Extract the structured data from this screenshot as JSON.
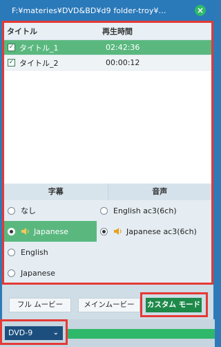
{
  "window": {
    "title": "F:¥materies¥DVD&BD¥d9 folder-troy¥…",
    "close_icon": "×"
  },
  "titles_table": {
    "headers": {
      "title": "タイトル",
      "duration": "再生時間"
    },
    "rows": [
      {
        "name": "タイトル_1",
        "duration": "02:42:36",
        "checked": true,
        "selected": true
      },
      {
        "name": "タイトル_2",
        "duration": "00:00:12",
        "checked": true,
        "selected": false
      }
    ]
  },
  "tracks": {
    "subtitle_header": "字幕",
    "audio_header": "音声",
    "subtitles": [
      {
        "label": "なし",
        "selected": false
      },
      {
        "label": "Japanese",
        "selected": true,
        "icon": "speaker-icon"
      },
      {
        "label": "English",
        "selected": false
      },
      {
        "label": "Japanese",
        "selected": false
      }
    ],
    "audio": [
      {
        "label": "English ac3(6ch)",
        "selected": false
      },
      {
        "label": "Japanese ac3(6ch)",
        "selected": true,
        "icon": "speaker-icon"
      }
    ]
  },
  "modes": {
    "full_movie": "フル ムービー",
    "main_movie": "メインムービー",
    "custom_mode": "カスタム モード"
  },
  "output": {
    "disc_type": "DVD-9"
  },
  "colors": {
    "accent_green": "#5ab87f",
    "highlight_red": "#e53935",
    "titlebar_blue": "#2a79b9"
  }
}
